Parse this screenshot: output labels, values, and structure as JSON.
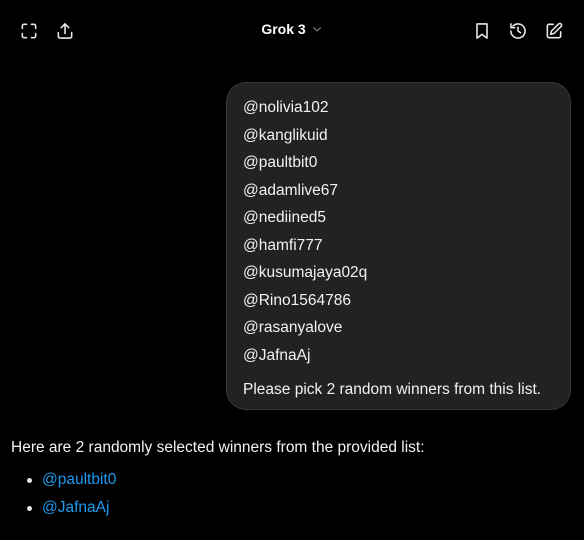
{
  "topbar": {
    "left_icons": [
      "fullscreen-icon",
      "share-icon"
    ],
    "model_name": "Grok 3",
    "model_dropdown_icon": "chevron-down-icon",
    "right_icons": [
      "bookmark-icon",
      "history-icon",
      "new-chat-icon"
    ]
  },
  "user_message": {
    "handles": [
      "@nolivia102",
      "@kanglikuid",
      "@paultbit0",
      "@adamlive67",
      "@nediined5",
      "@hamfi777",
      "@kusumajaya02q",
      "@Rino1564786",
      "@rasanyalove",
      "@JafnaAj"
    ],
    "prompt": "Please pick 2 random winners from this list."
  },
  "response": {
    "intro": "Here are 2 randomly selected winners from the provided list:",
    "winners": [
      "@paultbit0",
      "@JafnaAj"
    ]
  },
  "colors": {
    "background": "#000000",
    "bubble": "#202224",
    "link": "#1d9bf0",
    "text": "#f2f2f2"
  }
}
